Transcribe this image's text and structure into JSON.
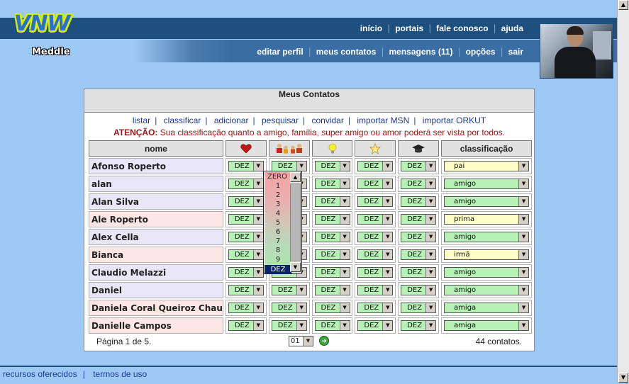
{
  "brand": {
    "logo": "VNW",
    "tagline": "Meddle"
  },
  "nav_primary": [
    "início",
    "portais",
    "fale conosco",
    "ajuda"
  ],
  "nav_secondary": [
    "editar perfil",
    "meus contatos",
    "mensagens (11)",
    "opções",
    "sair"
  ],
  "panel": {
    "title": "Meus Contatos",
    "actions": [
      "listar",
      "classificar",
      "adicionar",
      "pesquisar",
      "convidar",
      "importar MSN",
      "importar ORKUT"
    ],
    "warning_label": "ATENÇÃO:",
    "warning_text": "Sua classificação quanto a amigo, família, super amigo ou amor poderá ser vista por todos."
  },
  "table": {
    "headers": {
      "name": "nome",
      "classification": "classificação"
    },
    "header_icons": [
      "heart-icon",
      "family-icon",
      "lightbulb-icon",
      "star-icon",
      "graduation-cap-icon"
    ],
    "rows": [
      {
        "name": "Afonso Roperto",
        "scores": [
          "DEZ",
          "DEZ",
          "DEZ",
          "DEZ",
          "DEZ"
        ],
        "classification": "pai",
        "highlight": "yellow",
        "bg": "#e9e6f8"
      },
      {
        "name": "alan",
        "scores": [
          "DEZ",
          "DEZ",
          "DEZ",
          "DEZ",
          "DEZ"
        ],
        "classification": "amigo",
        "highlight": "green",
        "bg": "#e9e6f8"
      },
      {
        "name": "Alan Silva",
        "scores": [
          "DEZ",
          "DEZ",
          "DEZ",
          "DEZ",
          "DEZ"
        ],
        "classification": "amigo",
        "highlight": "green",
        "bg": "#e9e6f8"
      },
      {
        "name": "Ale Roperto",
        "scores": [
          "DEZ",
          "DEZ",
          "DEZ",
          "DEZ",
          "DEZ"
        ],
        "classification": "prima",
        "highlight": "yellow",
        "bg": "#fde6e6"
      },
      {
        "name": "Alex Cella",
        "scores": [
          "DEZ",
          "DEZ",
          "DEZ",
          "DEZ",
          "DEZ"
        ],
        "classification": "amigo",
        "highlight": "green",
        "bg": "#e9e6f8"
      },
      {
        "name": "Bianca",
        "scores": [
          "DEZ",
          "DEZ",
          "DEZ",
          "DEZ",
          "DEZ"
        ],
        "classification": "irmã",
        "highlight": "yellow",
        "bg": "#fde6e6"
      },
      {
        "name": "Claudio Melazzi",
        "scores": [
          "DEZ",
          "DEZ",
          "DEZ",
          "DEZ",
          "DEZ"
        ],
        "classification": "amigo",
        "highlight": "green",
        "bg": "#e9e6f8"
      },
      {
        "name": "Daniel",
        "scores": [
          "DEZ",
          "DEZ",
          "DEZ",
          "DEZ",
          "DEZ"
        ],
        "classification": "amigo",
        "highlight": "green",
        "bg": "#e9e6f8"
      },
      {
        "name": "Daniela Coral Queiroz Chau",
        "scores": [
          "DEZ",
          "DEZ",
          "DEZ",
          "DEZ",
          "DEZ"
        ],
        "classification": "amiga",
        "highlight": "green",
        "bg": "#fde6e6"
      },
      {
        "name": "Danielle Campos",
        "scores": [
          "DEZ",
          "DEZ",
          "DEZ",
          "DEZ",
          "DEZ"
        ],
        "classification": "amiga",
        "highlight": "green",
        "bg": "#fde6e6"
      }
    ]
  },
  "dropdown_popup": {
    "options": [
      "ZERO",
      "1",
      "2",
      "3",
      "4",
      "5",
      "6",
      "7",
      "8",
      "9",
      "DEZ"
    ],
    "selected": "DEZ"
  },
  "pagination": {
    "page_label": "Página 1 de 5.",
    "page_select": "01",
    "count_label": "44 contatos."
  },
  "footer_links": [
    "recursos oferecidos",
    "termos de uso"
  ],
  "colors": {
    "header_bar": "#1d4f7f",
    "background": "#9cc9f5",
    "select_green": "#b6f2b6",
    "select_yellow": "#ffffc8"
  }
}
